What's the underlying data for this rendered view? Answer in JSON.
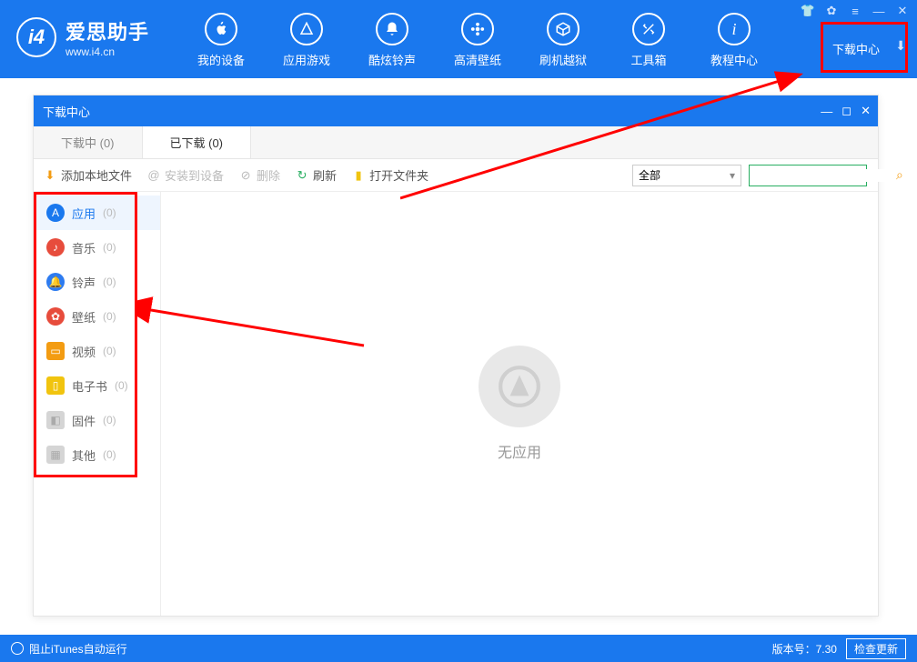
{
  "logo": {
    "title": "爱思助手",
    "subtitle": "www.i4.cn",
    "badge": "i4"
  },
  "nav": [
    {
      "label": "我的设备"
    },
    {
      "label": "应用游戏"
    },
    {
      "label": "酷炫铃声"
    },
    {
      "label": "高清壁纸"
    },
    {
      "label": "刷机越狱"
    },
    {
      "label": "工具箱"
    },
    {
      "label": "教程中心"
    }
  ],
  "download_center": "下载中心",
  "panel": {
    "title": "下载中心",
    "tabs": [
      {
        "label": "下载中 (0)"
      },
      {
        "label": "已下载 (0)"
      }
    ],
    "toolbar": {
      "add_local": "添加本地文件",
      "install": "安装到设备",
      "delete": "删除",
      "refresh": "刷新",
      "open_folder": "打开文件夹"
    },
    "filter": {
      "selected": "全部"
    },
    "sidebar": [
      {
        "label": "应用",
        "count": "(0)",
        "color": "#1a78ee"
      },
      {
        "label": "音乐",
        "count": "(0)",
        "color": "#e74c3c"
      },
      {
        "label": "铃声",
        "count": "(0)",
        "color": "#2d7bf0"
      },
      {
        "label": "壁纸",
        "count": "(0)",
        "color": "#e74c3c"
      },
      {
        "label": "视频",
        "count": "(0)",
        "color": "#f39c12"
      },
      {
        "label": "电子书",
        "count": "(0)",
        "color": "#f1c40f"
      },
      {
        "label": "固件",
        "count": "(0)",
        "color": "#bdc3c7"
      },
      {
        "label": "其他",
        "count": "(0)",
        "color": "#95a5a6"
      }
    ],
    "empty": "无应用"
  },
  "statusbar": {
    "itunes": "阻止iTunes自动运行",
    "version_label": "版本号：7.30",
    "check_update": "检查更新"
  }
}
